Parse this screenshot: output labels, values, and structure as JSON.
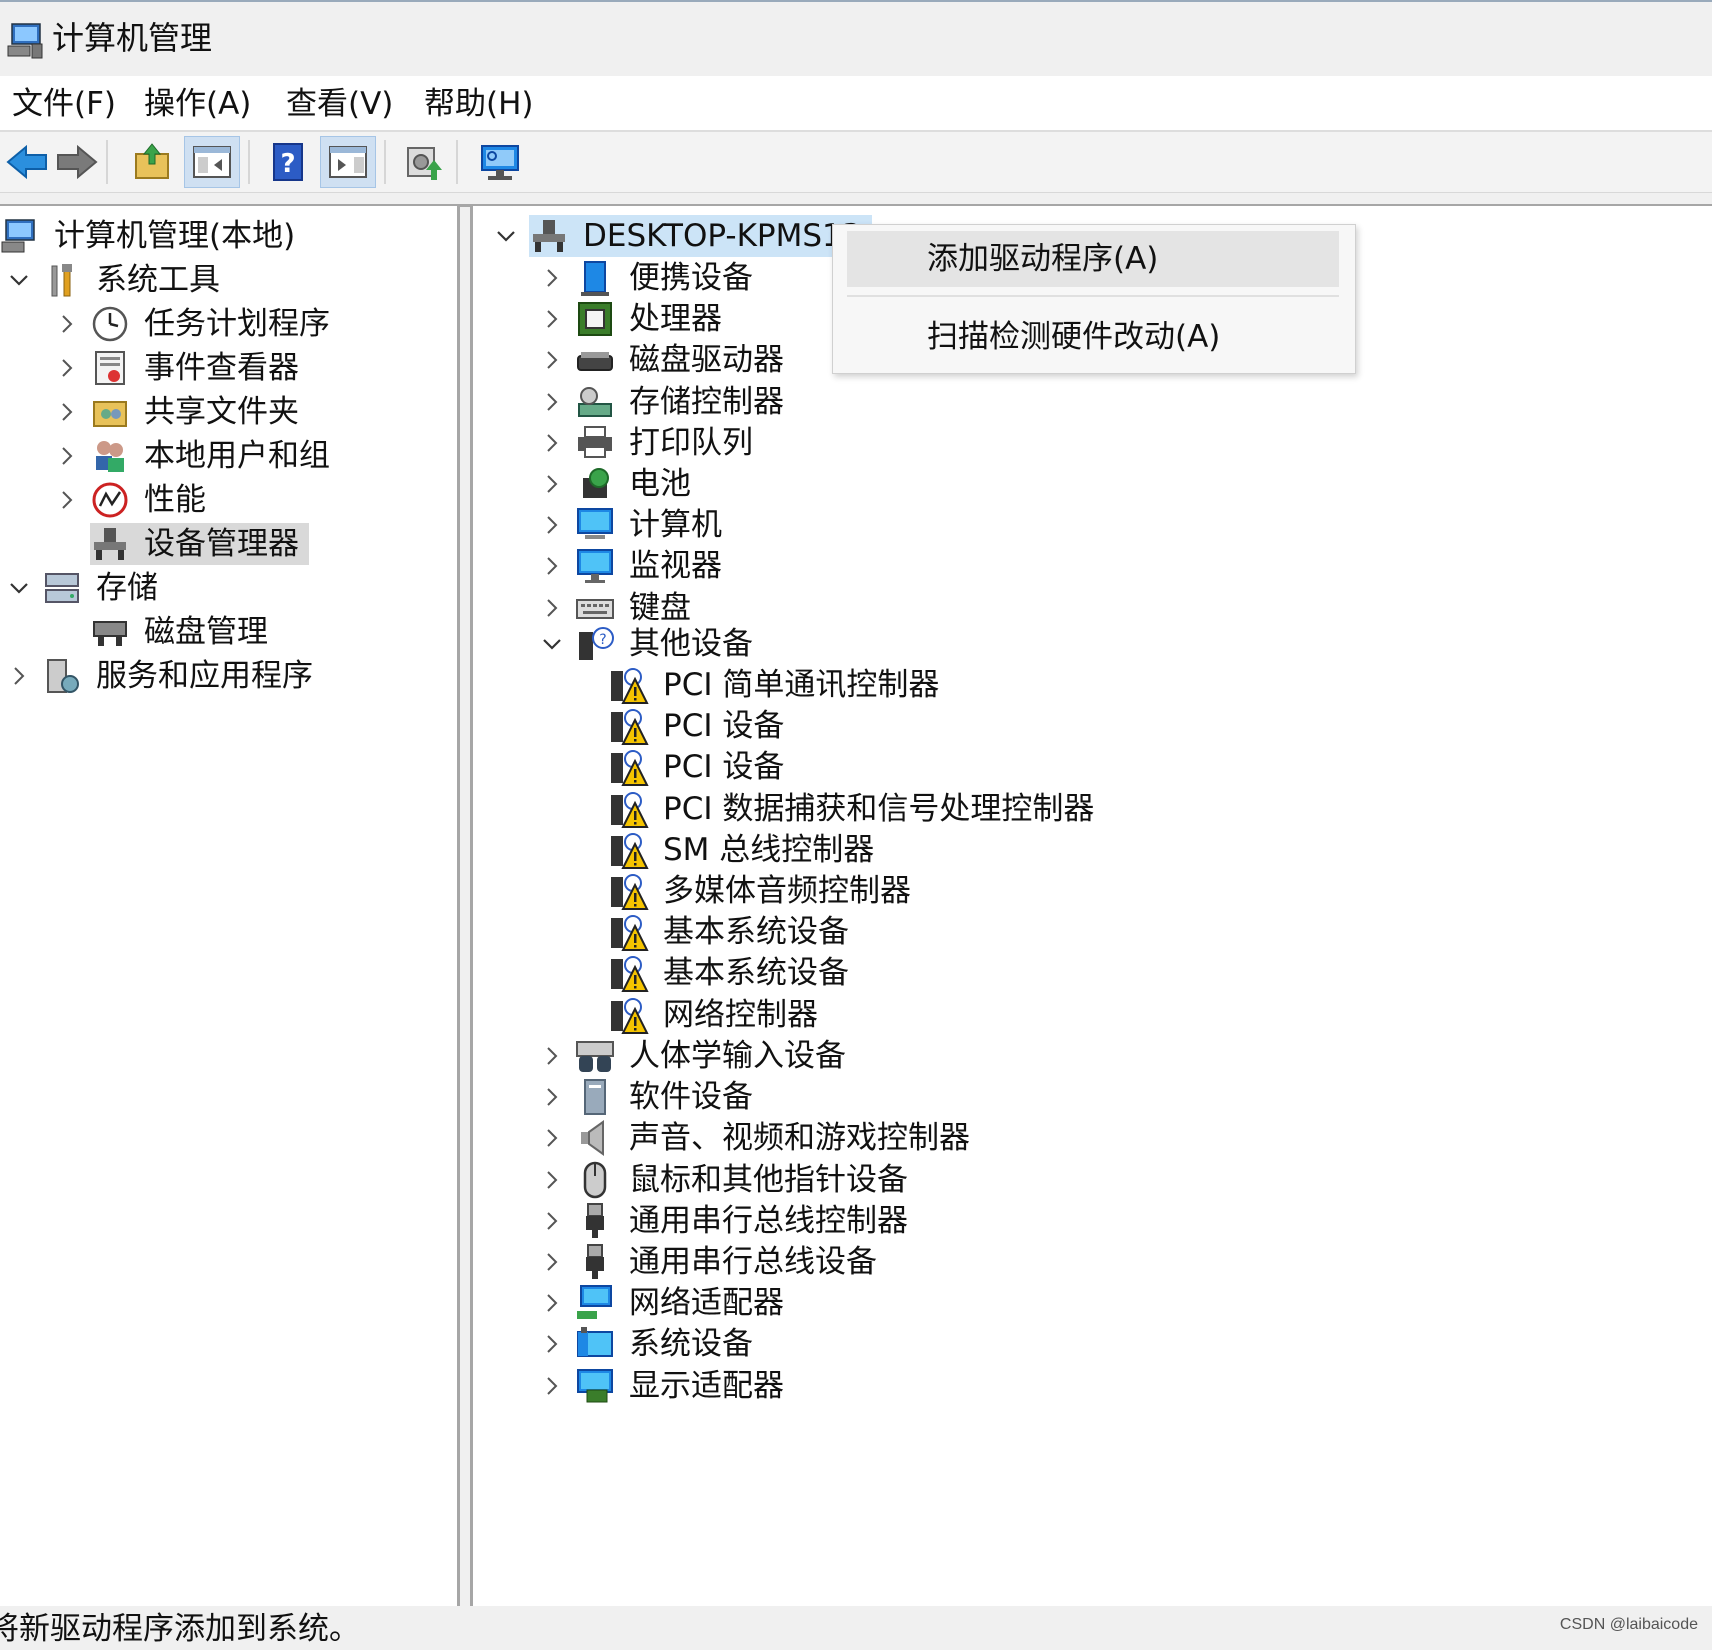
{
  "window": {
    "title": "计算机管理"
  },
  "menu": [
    "文件(F)",
    "操作(A)",
    "查看(V)",
    "帮助(H)"
  ],
  "toolbar": {
    "buttons": [
      "back-icon",
      "forward-icon",
      "up-folder-icon",
      "show-hide-tree-icon",
      "help-icon",
      "show-action-pane-icon",
      "update-driver-icon",
      "monitor-icon"
    ]
  },
  "left_tree": {
    "root": "计算机管理(本地)",
    "system_tools": "系统工具",
    "task_scheduler": "任务计划程序",
    "event_viewer": "事件查看器",
    "shared_folders": "共享文件夹",
    "local_users": "本地用户和组",
    "performance": "性能",
    "device_manager": "设备管理器",
    "storage": "存储",
    "disk_management": "磁盘管理",
    "services_apps": "服务和应用程序"
  },
  "device_tree": {
    "computer_name": "DESKTOP-KPMS13",
    "categories_top": [
      "便携设备",
      "处理器",
      "磁盘驱动器",
      "存储控制器",
      "打印队列",
      "电池",
      "计算机",
      "监视器",
      "键盘"
    ],
    "other_devices": "其他设备",
    "other_children": [
      "PCI 简单通讯控制器",
      "PCI 设备",
      "PCI 设备",
      "PCI 数据捕获和信号处理控制器",
      "SM 总线控制器",
      "多媒体音频控制器",
      "基本系统设备",
      "基本系统设备",
      "网络控制器"
    ],
    "categories_bottom": [
      "人体学输入设备",
      "软件设备",
      "声音、视频和游戏控制器",
      "鼠标和其他指针设备",
      "通用串行总线控制器",
      "通用串行总线设备",
      "网络适配器",
      "系统设备",
      "显示适配器"
    ]
  },
  "context_menu": {
    "add_driver": "添加驱动程序(A)",
    "scan_hardware": "扫描检测硬件改动(A)"
  },
  "status": {
    "text": "将新驱动程序添加到系统。",
    "watermark": "CSDN @laibaicode"
  },
  "colors": {
    "selection": "#d9d9d9",
    "warning": "#f5c400",
    "monitor_blue": "#1e88e5"
  }
}
